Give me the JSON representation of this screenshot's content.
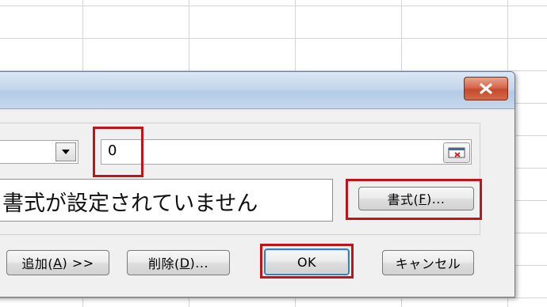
{
  "spreadsheet": {
    "grid": "visible"
  },
  "dialog": {
    "close_icon": "close-icon",
    "condition": {
      "operator_dropdown_icon": "chevron-down-icon",
      "value": "0",
      "range_select_icon": "collapse-dialog-icon"
    },
    "preview_text": "書式が設定されていません",
    "format_button": {
      "label_pre": "書式(",
      "accel": "F",
      "label_post": ")..."
    },
    "add_button": {
      "label_pre": "追加(",
      "accel": "A",
      "label_post": ") >>"
    },
    "delete_button": {
      "label_pre": "削除(",
      "accel": "D",
      "label_post": ")..."
    },
    "ok_label": "OK",
    "cancel_label": "キャンセル"
  },
  "colors": {
    "highlight": "#c0141b",
    "close_button": "#c44a2c",
    "titlebar": "#c4d7ec"
  }
}
